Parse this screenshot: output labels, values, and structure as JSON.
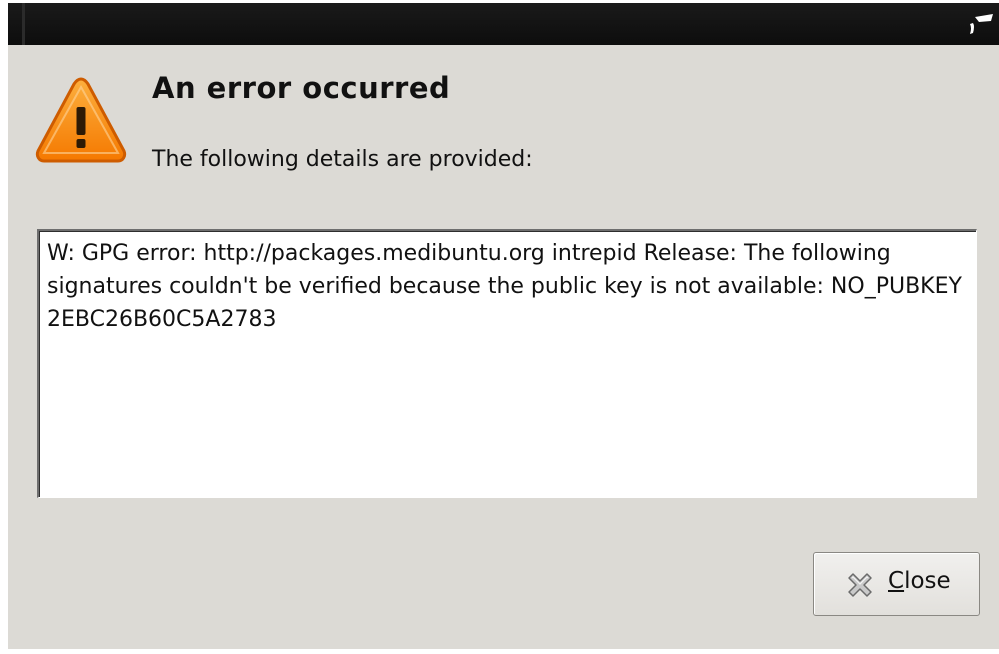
{
  "dialog": {
    "heading": "An error occurred",
    "subtext": "The following details are provided:",
    "details_text": "W: GPG error: http://packages.medibuntu.org intrepid Release: The following signatures couldn't be verified because the public key is not available: NO_PUBKEY 2EBC26B60C5A2783"
  },
  "close_button": {
    "mnemonic": "C",
    "rest": "lose",
    "icon": "close-x-icon"
  },
  "icons": {
    "warning": "warning-triangle-icon",
    "titlebar": "window-manager-logo-icon"
  },
  "colors": {
    "dialog_bg": "#dcdad5",
    "titlebar_bg": "#111111",
    "warning_orange": "#f57900",
    "details_bg": "#ffffff"
  }
}
